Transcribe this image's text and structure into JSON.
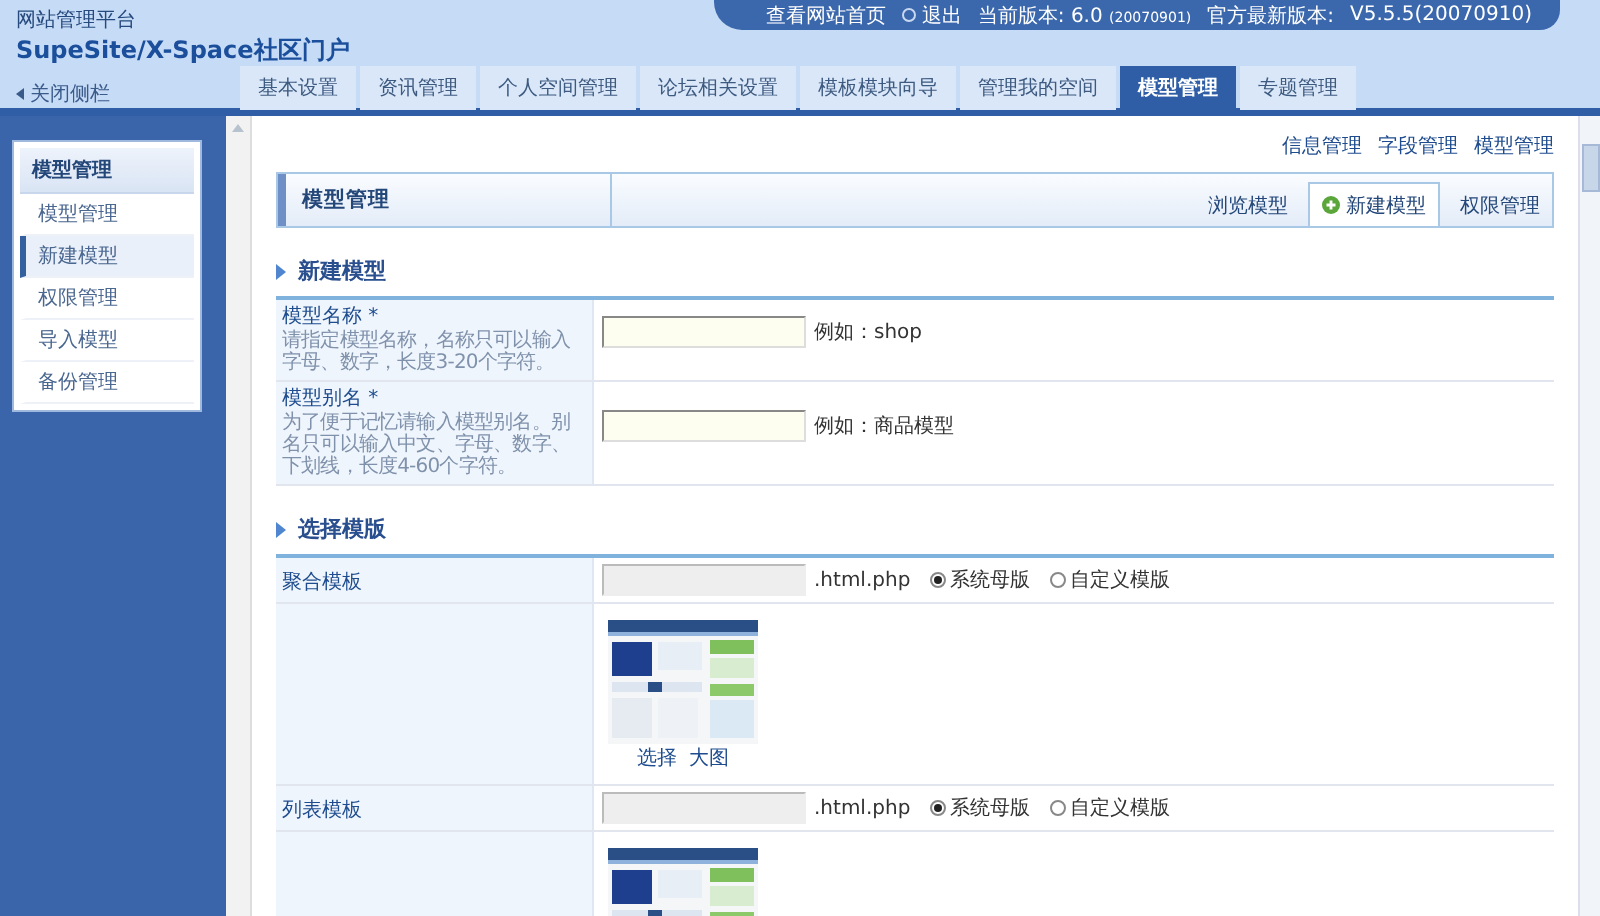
{
  "header": {
    "platform": "网站管理平台",
    "product": "SupeSite/X-Space社区门户",
    "close_sidebar": "关闭侧栏"
  },
  "top_bar": {
    "view_site": "查看网站首页",
    "logout": "退出",
    "current_version_label": "当前版本: 6.0",
    "current_version_build": "(20070901)",
    "latest_version_label": "官方最新版本:",
    "latest_version": "V5.5.5(20070910)"
  },
  "nav_tabs": [
    {
      "label": "基本设置",
      "selected": false
    },
    {
      "label": "资讯管理",
      "selected": false
    },
    {
      "label": "个人空间管理",
      "selected": false
    },
    {
      "label": "论坛相关设置",
      "selected": false
    },
    {
      "label": "模板模块向导",
      "selected": false
    },
    {
      "label": "管理我的空间",
      "selected": false
    },
    {
      "label": "模型管理",
      "selected": true
    },
    {
      "label": "专题管理",
      "selected": false
    }
  ],
  "sidebar": {
    "title": "模型管理",
    "items": [
      {
        "label": "模型管理",
        "selected": false
      },
      {
        "label": "新建模型",
        "selected": true
      },
      {
        "label": "权限管理",
        "selected": false
      },
      {
        "label": "导入模型",
        "selected": false
      },
      {
        "label": "备份管理",
        "selected": false
      }
    ]
  },
  "top_links": [
    "信息管理",
    "字段管理",
    "模型管理"
  ],
  "panel": {
    "title": "模型管理",
    "tabs": [
      {
        "label": "浏览模型",
        "selected": false
      },
      {
        "label": "新建模型",
        "selected": true
      },
      {
        "label": "权限管理",
        "selected": false
      }
    ]
  },
  "sections": [
    {
      "title": "新建模型",
      "rows": [
        {
          "kind": "text",
          "label": "模型名称 *",
          "hint": "请指定模型名称，名称只可以输入字母、数字，长度3-20个字符。",
          "example": "例如：shop"
        },
        {
          "kind": "text",
          "label": "模型别名 *",
          "hint": "为了便于记忆请输入模型别名。别名只可以输入中文、字母、数字、下划线，长度4-60个字符。",
          "example": "例如：商品模型"
        }
      ]
    },
    {
      "title": "选择模版",
      "rows": [
        {
          "kind": "template",
          "label": "聚合模板",
          "suffix": ".html.php",
          "options": [
            {
              "label": "系统母版",
              "selected": true
            },
            {
              "label": "自定义模版",
              "selected": false
            }
          ]
        },
        {
          "kind": "preview",
          "links": [
            "选择",
            "大图"
          ]
        },
        {
          "kind": "template",
          "label": "列表模板",
          "suffix": ".html.php",
          "options": [
            {
              "label": "系统母版",
              "selected": true
            },
            {
              "label": "自定义模版",
              "selected": false
            }
          ]
        },
        {
          "kind": "preview"
        }
      ]
    }
  ]
}
